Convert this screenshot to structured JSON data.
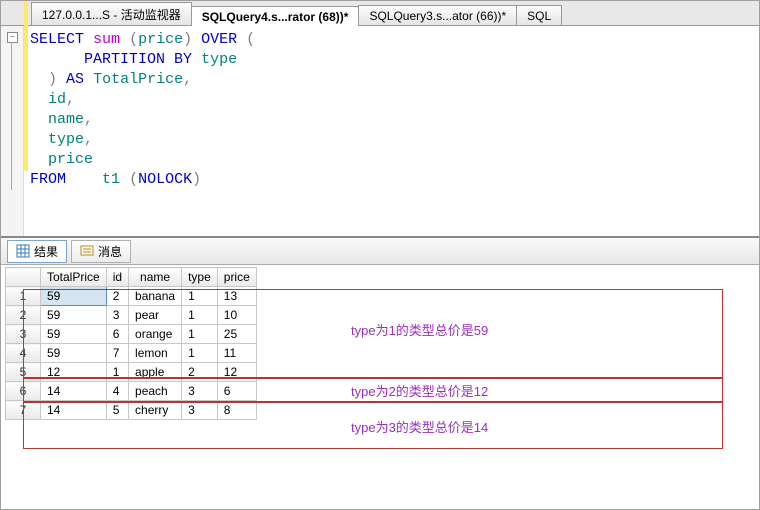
{
  "tabs": [
    {
      "label": "127.0.0.1...S - 活动监视器",
      "active": false
    },
    {
      "label": "SQLQuery4.s...rator (68))*",
      "active": true
    },
    {
      "label": "SQLQuery3.s...ator (66))*",
      "active": false
    },
    {
      "label": "SQL",
      "active": false
    }
  ],
  "sql": {
    "l1a": "SELECT",
    "l1b": "sum",
    "l1c": "(",
    "l1d": "price",
    "l1e": ")",
    "l1f": "OVER",
    "l1g": "(",
    "l2a": "PARTITION",
    "l2b": "BY",
    "l2c": "type",
    "l3a": ")",
    "l3b": "AS",
    "l3c": "TotalPrice",
    "l3d": ",",
    "l4a": "id",
    "l4b": ",",
    "l5a": "name",
    "l5b": ",",
    "l6a": "type",
    "l6b": ",",
    "l7a": "price",
    "l8a": "FROM",
    "l8b": "t1",
    "l8c": "(",
    "l8d": "NOLOCK",
    "l8e": ")"
  },
  "result_tabs": {
    "results": "结果",
    "messages": "消息"
  },
  "columns": [
    "TotalPrice",
    "id",
    "name",
    "type",
    "price"
  ],
  "rows": [
    {
      "n": "1",
      "TotalPrice": "59",
      "id": "2",
      "name": "banana",
      "type": "1",
      "price": "13"
    },
    {
      "n": "2",
      "TotalPrice": "59",
      "id": "3",
      "name": "pear",
      "type": "1",
      "price": "10"
    },
    {
      "n": "3",
      "TotalPrice": "59",
      "id": "6",
      "name": "orange",
      "type": "1",
      "price": "25"
    },
    {
      "n": "4",
      "TotalPrice": "59",
      "id": "7",
      "name": "lemon",
      "type": "1",
      "price": "11"
    },
    {
      "n": "5",
      "TotalPrice": "12",
      "id": "1",
      "name": "apple",
      "type": "2",
      "price": "12"
    },
    {
      "n": "6",
      "TotalPrice": "14",
      "id": "4",
      "name": "peach",
      "type": "3",
      "price": "6"
    },
    {
      "n": "7",
      "TotalPrice": "14",
      "id": "5",
      "name": "cherry",
      "type": "3",
      "price": "8"
    }
  ],
  "annotations": [
    {
      "text": "type为1的类型总价是59"
    },
    {
      "text": "type为2的类型总价是12"
    },
    {
      "text": "type为3的类型总价是14"
    }
  ]
}
